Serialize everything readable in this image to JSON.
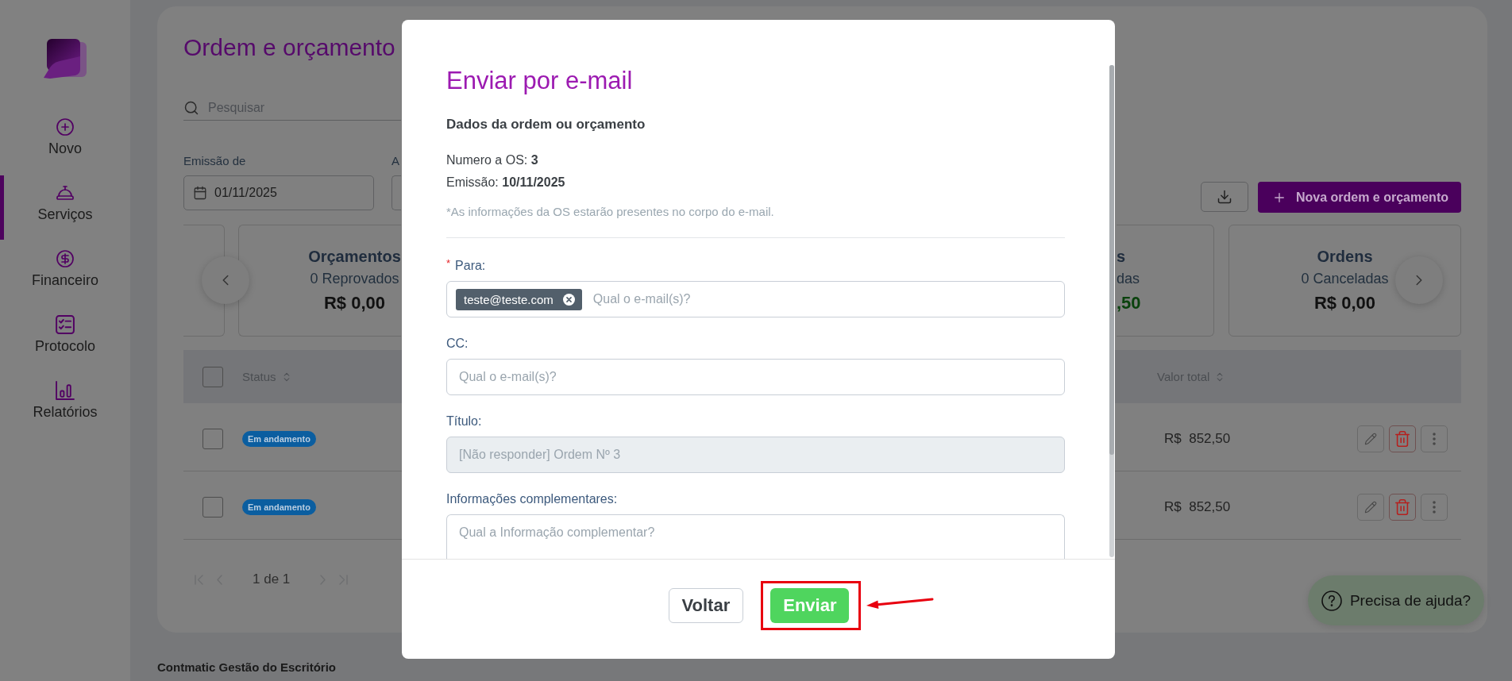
{
  "sidebar": {
    "items": [
      {
        "label": "Novo",
        "selected": false
      },
      {
        "label": "Serviços",
        "selected": true
      },
      {
        "label": "Financeiro",
        "selected": false
      },
      {
        "label": "Protocolo",
        "selected": false
      },
      {
        "label": "Relatórios",
        "selected": false
      }
    ]
  },
  "page": {
    "title": "Ordem e orçamento",
    "search": {
      "placeholder": "Pesquisar"
    },
    "filters": [
      {
        "label": "Emissão de",
        "value": "01/11/2025"
      },
      {
        "label": "A"
      }
    ],
    "new_button": "Nova ordem e orçamento",
    "summary_cards": [
      {
        "title": "Orçamentos",
        "subtitle": "0 Reprovados",
        "amount": "R$ 0,00",
        "color": "#111111"
      },
      {
        "title": "s",
        "subtitle": "das",
        "amount": ",50",
        "color": "#0a420d"
      },
      {
        "title": "Ordens",
        "subtitle": "0 Canceladas",
        "amount": "R$ 0,00",
        "color": "#111111"
      }
    ],
    "table": {
      "select_all": {
        "checked": false
      },
      "columns": [
        "Status",
        "Valor total"
      ],
      "rows": [
        {
          "checked": false,
          "status": "Em andamento",
          "total": "R$  852,50"
        },
        {
          "checked": false,
          "status": "Em andamento",
          "total": "R$  852,50"
        }
      ]
    },
    "pagination": {
      "label": "1 de 1"
    }
  },
  "help_button": {
    "label": "Precisa de ajuda?"
  },
  "footer": {
    "text": "Contmatic Gestão do Escritório"
  },
  "modal": {
    "title": "Enviar por e-mail",
    "section_title": "Dados da ordem ou orçamento",
    "details": [
      "Numero a OS: **3**",
      "Emissão: **10/11/2025**"
    ],
    "note": "*As informações da OS estarão presentes no corpo do e-mail.",
    "fields": [
      {
        "kind": "chips",
        "label": "Para:",
        "required_mark": "*",
        "chips": [
          "teste@teste.com"
        ],
        "placeholder": "Qual o e-mail(s)?",
        "disabled": false
      },
      {
        "kind": "input",
        "label": "CC:",
        "placeholder": "Qual o e-mail(s)?",
        "disabled": false
      },
      {
        "kind": "input",
        "label": "Título:",
        "value": "[Não responder] Ordem Nº 3",
        "disabled": true
      },
      {
        "kind": "textarea",
        "label": "Informações complementares:",
        "placeholder": "Qual a Informação complementar?",
        "disabled": false
      }
    ],
    "buttons": [
      {
        "label": "Voltar",
        "kind": "secondary",
        "highlighted": false
      },
      {
        "label": "Enviar",
        "kind": "primary",
        "highlighted": true
      }
    ]
  }
}
